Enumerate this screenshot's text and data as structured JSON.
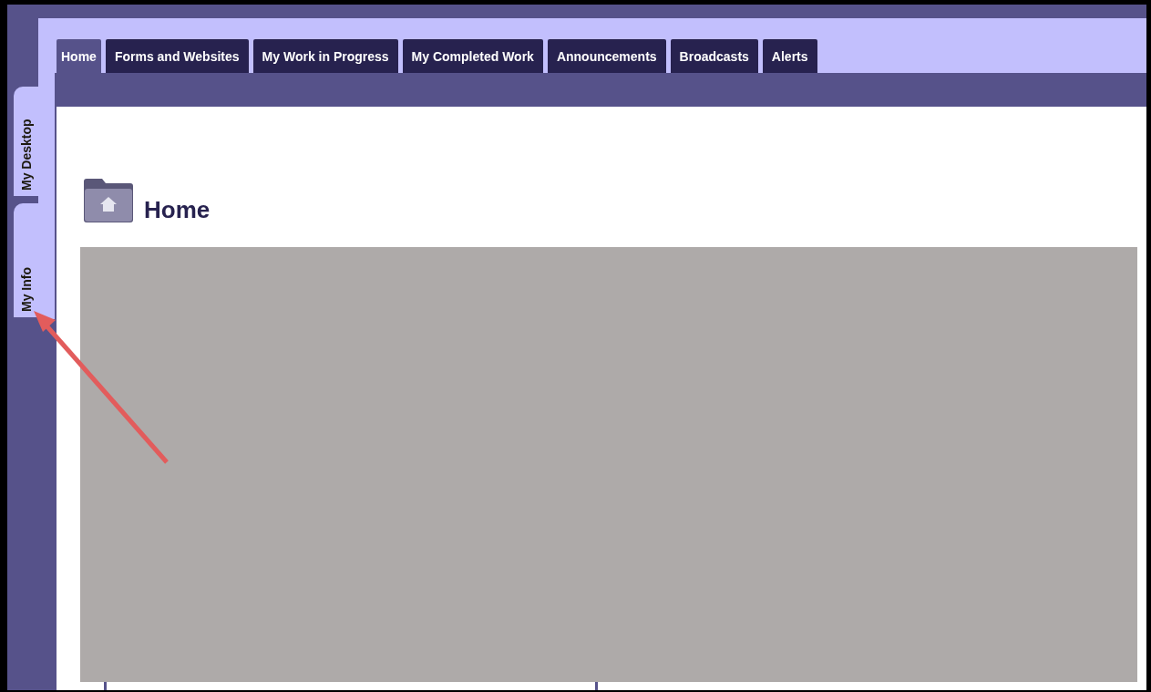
{
  "side_tabs": [
    {
      "label": "My Desktop"
    },
    {
      "label": "My Info"
    }
  ],
  "tabs": [
    {
      "label": "Home",
      "selected": true
    },
    {
      "label": "Forms and Websites",
      "selected": false
    },
    {
      "label": "My Work in Progress",
      "selected": false
    },
    {
      "label": "My Completed Work",
      "selected": false
    },
    {
      "label": "Announcements",
      "selected": false
    },
    {
      "label": "Broadcasts",
      "selected": false
    },
    {
      "label": "Alerts",
      "selected": false
    }
  ],
  "page": {
    "title": "Home"
  }
}
